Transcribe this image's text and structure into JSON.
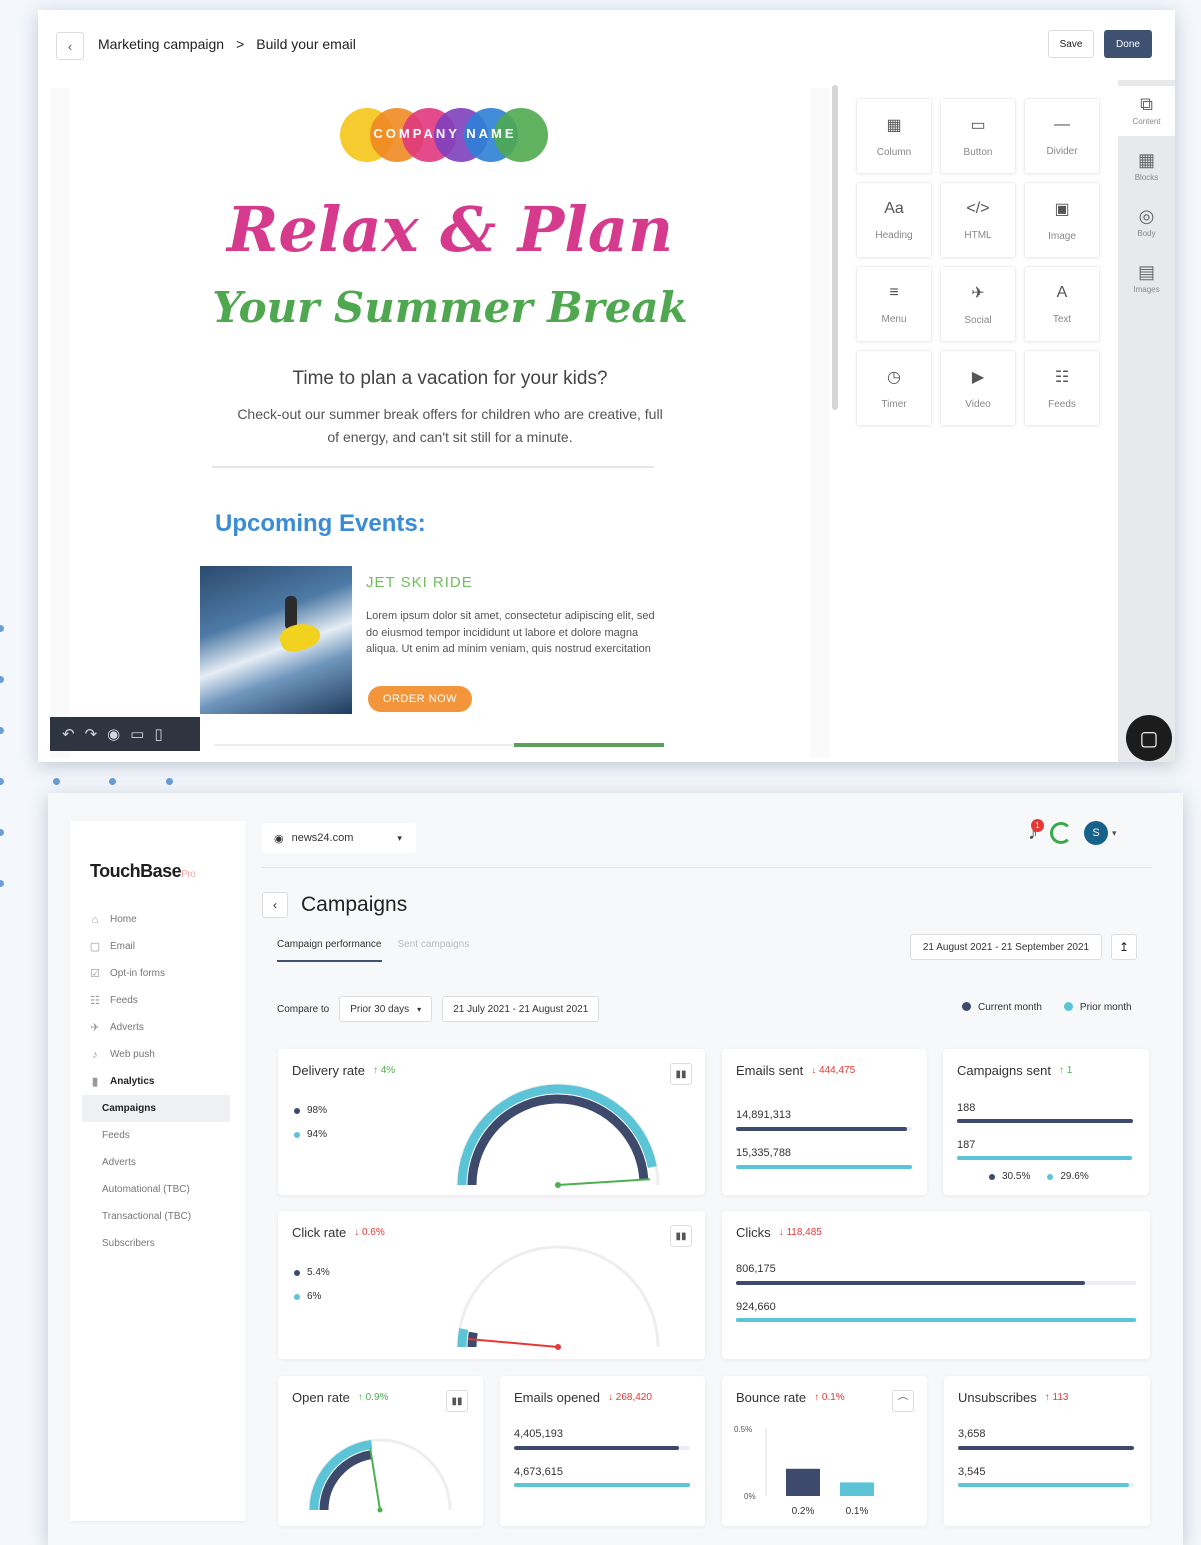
{
  "colors": {
    "current": "#3e4a6b",
    "prior": "#5bc4d6",
    "up": "#4caf50",
    "down": "#e53935",
    "accent": "#3e5170",
    "logo_circles": [
      "#f5c518",
      "#f08a24",
      "#e0377d",
      "#7e3fbd",
      "#2f7fd6",
      "#4fa84f"
    ]
  },
  "editor": {
    "breadcrumb": {
      "parent": "Marketing campaign",
      "separator": ">",
      "current": "Build your email"
    },
    "save_label": "Save",
    "done_label": "Done",
    "email": {
      "logo_text": "COMPANY NAME",
      "headline": "Relax & Plan",
      "subheadline": "Your Summer Break",
      "question": "Time to plan a vacation for your kids?",
      "body": "Check-out our summer break offers for children who are creative, full of energy, and can't sit still for a minute.",
      "section_title": "Upcoming Events:",
      "event": {
        "title": "JET SKI RIDE",
        "text": "Lorem ipsum dolor sit amet, consectetur adipiscing elit, sed do eiusmod tempor incididunt ut labore et dolore magna aliqua. Ut enim ad minim veniam, quis nostrud exercitation",
        "button": "ORDER NOW"
      }
    },
    "blocks": [
      {
        "label": "Column",
        "icon": "column-icon",
        "glyph": "▦"
      },
      {
        "label": "Button",
        "icon": "button-icon",
        "glyph": "▭"
      },
      {
        "label": "Divider",
        "icon": "divider-icon",
        "glyph": "—"
      },
      {
        "label": "Heading",
        "icon": "heading-icon",
        "glyph": "Aa"
      },
      {
        "label": "HTML",
        "icon": "html-icon",
        "glyph": "</>"
      },
      {
        "label": "Image",
        "icon": "image-icon",
        "glyph": "▣"
      },
      {
        "label": "Menu",
        "icon": "menu-icon",
        "glyph": "≡"
      },
      {
        "label": "Social",
        "icon": "social-icon",
        "glyph": "✈"
      },
      {
        "label": "Text",
        "icon": "text-icon",
        "glyph": "A"
      },
      {
        "label": "Timer",
        "icon": "timer-icon",
        "glyph": "◷"
      },
      {
        "label": "Video",
        "icon": "video-icon",
        "glyph": "▶"
      },
      {
        "label": "Feeds",
        "icon": "feeds-icon",
        "glyph": "☷"
      }
    ],
    "rail": [
      {
        "label": "Content",
        "icon": "content-icon",
        "glyph": "⧉"
      },
      {
        "label": "Blocks",
        "icon": "blocks-icon",
        "glyph": "▦"
      },
      {
        "label": "Body",
        "icon": "body-icon",
        "glyph": "◎"
      },
      {
        "label": "Images",
        "icon": "images-icon",
        "glyph": "▤"
      }
    ]
  },
  "dashboard": {
    "brand": "TouchBase",
    "brand_suffix": "Pro",
    "domain": "news24.com",
    "nav": [
      {
        "label": "Home",
        "icon": "home-icon",
        "glyph": "⌂"
      },
      {
        "label": "Email",
        "icon": "email-icon",
        "glyph": "▢"
      },
      {
        "label": "Opt-in forms",
        "icon": "forms-icon",
        "glyph": "☑"
      },
      {
        "label": "Feeds",
        "icon": "feeds-icon",
        "glyph": "☷"
      },
      {
        "label": "Adverts",
        "icon": "adverts-icon",
        "glyph": "✈"
      },
      {
        "label": "Web push",
        "icon": "bell-icon",
        "glyph": "♪"
      },
      {
        "label": "Analytics",
        "icon": "analytics-icon",
        "glyph": "▮"
      }
    ],
    "subnav": [
      "Campaigns",
      "Feeds",
      "Adverts",
      "Automational (TBC)",
      "Transactional (TBC)",
      "Subscribers"
    ],
    "notifications": "1",
    "avatar": "S",
    "page_title": "Campaigns",
    "tabs": [
      "Campaign performance",
      "Sent campaigns"
    ],
    "date_range": "21 August 2021 - 21 September 2021",
    "compare_label": "Compare to",
    "compare_select": "Prior 30 days",
    "compare_range": "21 July 2021 - 21 August 2021",
    "legend": {
      "current": "Current month",
      "prior": "Prior month"
    },
    "cards": {
      "delivery": {
        "title": "Delivery rate",
        "delta": "4%",
        "current": "98%",
        "prior": "94%",
        "current_value": 98,
        "prior_value": 94
      },
      "emails_sent": {
        "title": "Emails sent",
        "delta": "444,475",
        "current": "14,891,313",
        "prior": "15,335,788",
        "current_frac": 0.97,
        "prior_frac": 1.0
      },
      "campaigns_sent": {
        "title": "Campaigns sent",
        "delta": "1",
        "current": "188",
        "prior": "187",
        "current_pct": "30.5%",
        "prior_pct": "29.6%",
        "current_frac": 1.0,
        "prior_frac": 0.995
      },
      "click": {
        "title": "Click rate",
        "delta": "0.6%",
        "current": "5.4%",
        "prior": "6%",
        "current_value": 5.4,
        "prior_value": 6
      },
      "clicks": {
        "title": "Clicks",
        "delta": "118,485",
        "current": "806,175",
        "prior": "924,660",
        "current_frac": 0.872,
        "prior_frac": 1.0
      },
      "open": {
        "title": "Open rate",
        "delta": "0.9%",
        "current_value": 45,
        "prior_value": 46
      },
      "emails_opened": {
        "title": "Emails opened",
        "delta": "268,420",
        "current": "4,405,193",
        "prior": "4,673,615",
        "current_frac": 0.94,
        "prior_frac": 1.0
      },
      "bounce": {
        "title": "Bounce rate",
        "delta": "0.1%",
        "y_max": "0.5%",
        "y_min": "0%",
        "current": "0.2%",
        "prior": "0.1%",
        "current_value": 0.2,
        "prior_value": 0.1
      },
      "unsubscribes": {
        "title": "Unsubscribes",
        "delta": "113",
        "current": "3,658",
        "prior": "3,545",
        "current_frac": 1.0,
        "prior_frac": 0.97
      }
    }
  }
}
